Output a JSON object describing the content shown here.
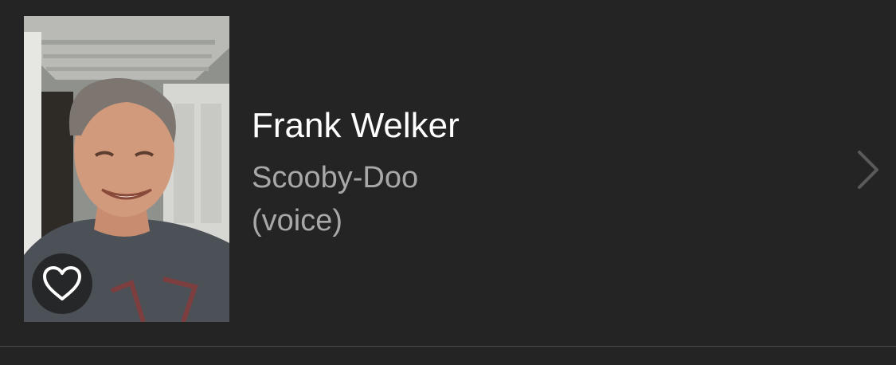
{
  "cast_member": {
    "name": "Frank Welker",
    "character": "Scooby-Doo",
    "credit_note": "(voice)",
    "photo_icon": "person-photo",
    "favorite_icon": "heart-outline-icon",
    "disclosure_icon": "chevron-right-icon"
  },
  "colors": {
    "background": "#242424",
    "name_text": "#ffffff",
    "secondary_text": "#a8a8a8",
    "chevron": "#5a5a5a",
    "separator": "#4a4a4a"
  }
}
